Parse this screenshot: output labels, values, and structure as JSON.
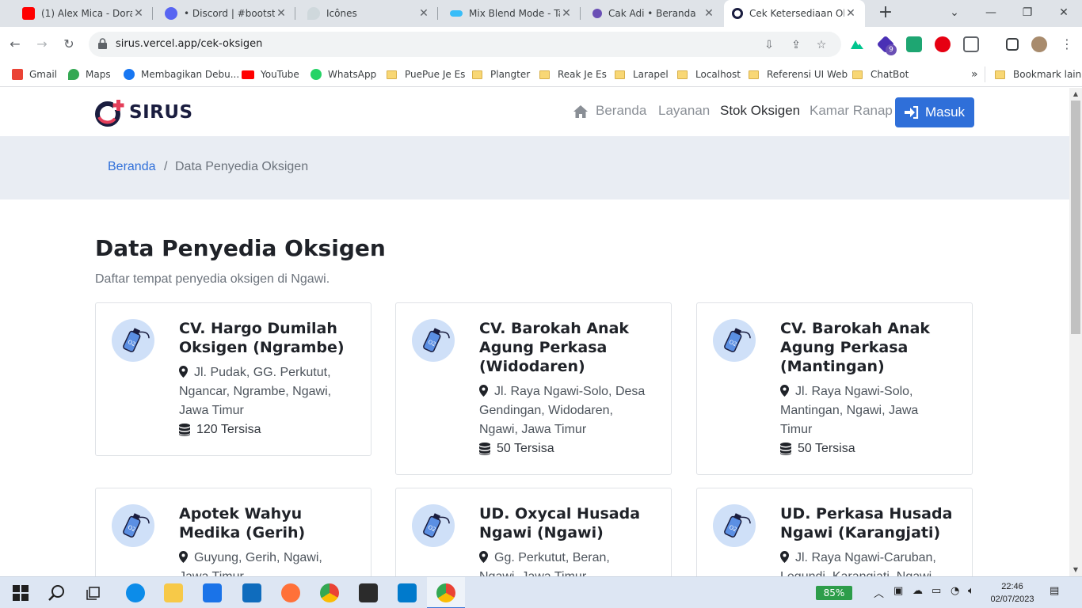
{
  "browser": {
    "tabs": [
      {
        "title": "(1) Alex Mica - Dora",
        "favicon_color": "#ff0000"
      },
      {
        "title": "• Discord | #bootstra",
        "favicon_color": "#5865f2"
      },
      {
        "title": "Icônes",
        "favicon_color": "#b0bec5"
      },
      {
        "title": "Mix Blend Mode - Ta",
        "favicon_color": "#38bdf8"
      },
      {
        "title": "Cak Adi • Beranda",
        "favicon_color": "#6a4fb5"
      },
      {
        "title": "Cek Ketersediaan Ok",
        "favicon_color": "#1a1d3f",
        "active": true
      }
    ],
    "url": "sirus.vercel.app/cek-oksigen",
    "bookmarks": [
      {
        "label": "Gmail",
        "type": "link",
        "color": "#ea4335"
      },
      {
        "label": "Maps",
        "type": "link",
        "color": "#34a853"
      },
      {
        "label": "Membagikan Debu...",
        "type": "link",
        "color": "#1877f2"
      },
      {
        "label": "YouTube",
        "type": "link",
        "color": "#ff0000"
      },
      {
        "label": "WhatsApp",
        "type": "link",
        "color": "#25d366"
      },
      {
        "label": "PuePue Je Es",
        "type": "folder"
      },
      {
        "label": "Plangter",
        "type": "folder"
      },
      {
        "label": "Reak Je Es",
        "type": "folder"
      },
      {
        "label": "Larapel",
        "type": "folder"
      },
      {
        "label": "Localhost",
        "type": "folder"
      },
      {
        "label": "Referensi UI Web",
        "type": "folder"
      },
      {
        "label": "ChatBot",
        "type": "folder"
      }
    ],
    "more_bookmarks": "»",
    "other_bookmarks": "Bookmark lain",
    "extension_badge": "9"
  },
  "site": {
    "brand": "SIRUS",
    "nav": {
      "beranda": "Beranda",
      "layanan": "Layanan",
      "stok": "Stok Oksigen",
      "kamar": "Kamar Ranap",
      "masuk": "Masuk"
    },
    "breadcrumb": {
      "home": "Beranda",
      "separator": "/",
      "current": "Data Penyedia Oksigen"
    },
    "title": "Data Penyedia Oksigen",
    "subtitle": "Daftar tempat penyedia oksigen di Ngawi.",
    "providers": [
      {
        "name": "CV. Hargo Dumilah Oksigen (Ngrambe)",
        "address": "Jl. Pudak, GG. Perkutut, Ngancar, Ngrambe, Ngawi, Jawa Timur",
        "stock": "120 Tersisa"
      },
      {
        "name": "CV. Barokah Anak Agung Perkasa (Widodaren)",
        "address": "Jl. Raya Ngawi-Solo, Desa Gendingan, Widodaren, Ngawi, Jawa Timur",
        "stock": "50 Tersisa"
      },
      {
        "name": "CV. Barokah Anak Agung Perkasa (Mantingan)",
        "address": "Jl. Raya Ngawi-Solo, Mantingan, Ngawi, Jawa Timur",
        "stock": "50 Tersisa"
      },
      {
        "name": "Apotek Wahyu Medika (Gerih)",
        "address": "Guyung, Gerih, Ngawi, Jawa Timur",
        "stock": ""
      },
      {
        "name": "UD. Oxycal Husada Ngawi (Ngawi)",
        "address": "Gg. Perkutut, Beran, Ngawi, Jawa Timur",
        "stock": ""
      },
      {
        "name": "UD. Perkasa Husada Ngawi (Karangjati)",
        "address": "Jl. Raya Ngawi-Caruban, Legundi, Karangjati, Ngawi",
        "stock": ""
      }
    ]
  },
  "taskbar": {
    "battery": "85%",
    "time": "22:46",
    "date": "02/07/2023"
  }
}
